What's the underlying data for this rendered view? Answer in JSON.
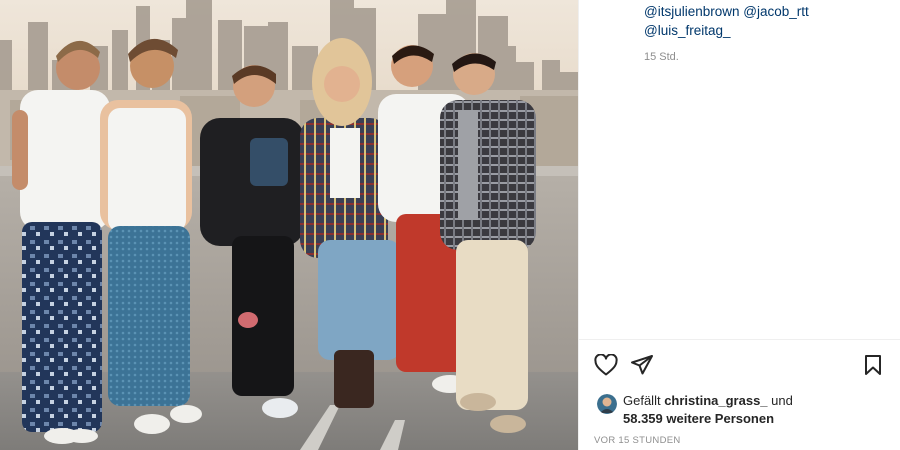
{
  "post": {
    "image_alt": "",
    "colors": {
      "sky": "#e9ded0",
      "wall": "#a8a39d",
      "floor": "#8b8a88",
      "link": "#00376b",
      "muted": "#8e8e8e"
    }
  },
  "caption": {
    "mentions": [
      "@itsjulienbrown",
      "@jacob_rtt",
      "@luis_freitag_"
    ],
    "relative_time": "15 Std."
  },
  "actions": {
    "like_icon": "heart-icon",
    "share_icon": "paper-plane-icon",
    "save_icon": "bookmark-icon"
  },
  "likes": {
    "prefix": "Gefällt",
    "user": "christina_grass_",
    "connector": "und",
    "others": "58.359 weitere Personen"
  },
  "posted": {
    "label": "VOR 15 STUNDEN"
  }
}
